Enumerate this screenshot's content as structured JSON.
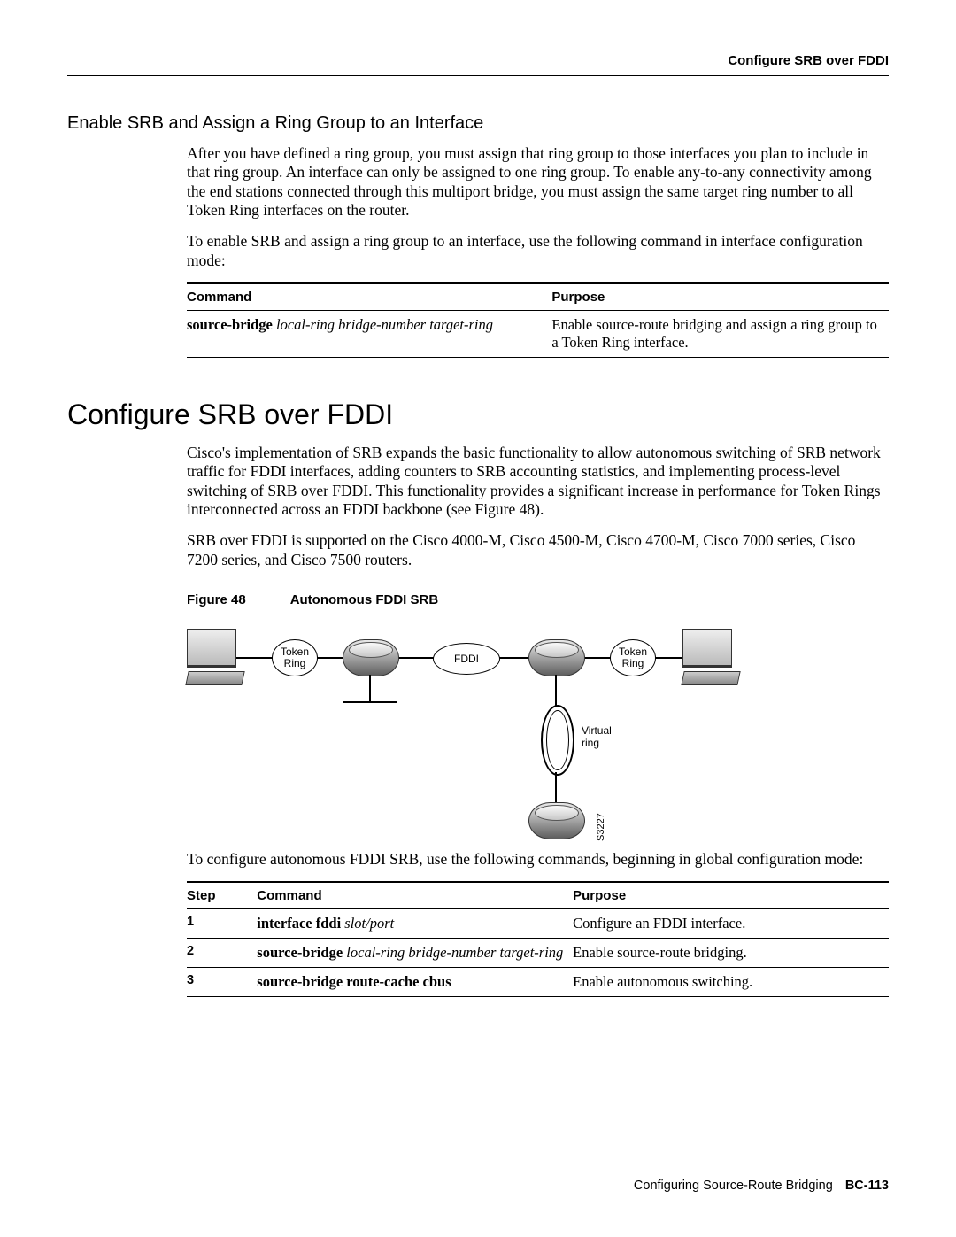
{
  "running_head": "Configure SRB over FDDI",
  "subsection_title": "Enable SRB and Assign a Ring Group to an Interface",
  "para1": "After you have defined a ring group, you must assign that ring group to those interfaces you plan to include in that ring group. An interface can only be assigned to one ring group. To enable any-to-any connectivity among the end stations connected through this multiport bridge, you must assign the same target ring number to all Token Ring interfaces on the router.",
  "para2": "To enable SRB and assign a ring group to an interface, use the following command in interface configuration mode:",
  "table1": {
    "head_command": "Command",
    "head_purpose": "Purpose",
    "cmd_bold": "source-bridge",
    "cmd_italic": " local-ring bridge-number target-ring",
    "purpose": "Enable source-route bridging and assign a ring group to a Token Ring interface."
  },
  "major_title": "Configure SRB over FDDI",
  "para3": "Cisco's implementation of SRB expands the basic functionality to allow autonomous switching of SRB network traffic for FDDI interfaces, adding counters to SRB accounting statistics, and implementing process-level switching of SRB over FDDI. This functionality provides a significant increase in performance for Token Rings interconnected across an FDDI backbone (see Figure 48).",
  "para4": "SRB over FDDI is supported on the Cisco 4000-M, Cisco 4500-M, Cisco 4700-M, Cisco 7000 series, Cisco 7200 series, and Cisco 7500 routers.",
  "figure": {
    "num": "Figure 48",
    "title": "Autonomous FDDI SRB",
    "token_ring_left": "Token\nRing",
    "token_ring_right": "Token\nRing",
    "fddi": "FDDI",
    "virtual_ring": "Virtual\nring",
    "diagram_id": "S3227"
  },
  "para5": "To configure autonomous FDDI SRB, use the following commands, beginning in global configuration mode:",
  "table2": {
    "head_step": "Step",
    "head_command": "Command",
    "head_purpose": "Purpose",
    "rows": [
      {
        "step": "1",
        "cmd_bold": "interface fddi",
        "cmd_italic": " slot/port",
        "purpose": "Configure an FDDI interface."
      },
      {
        "step": "2",
        "cmd_bold": "source-bridge",
        "cmd_italic": " local-ring bridge-number target-ring",
        "purpose": "Enable source-route bridging."
      },
      {
        "step": "3",
        "cmd_bold": "source-bridge route-cache cbus",
        "cmd_italic": "",
        "purpose": "Enable autonomous switching."
      }
    ]
  },
  "footer": {
    "chapter": "Configuring Source-Route Bridging",
    "page": "BC-113"
  }
}
